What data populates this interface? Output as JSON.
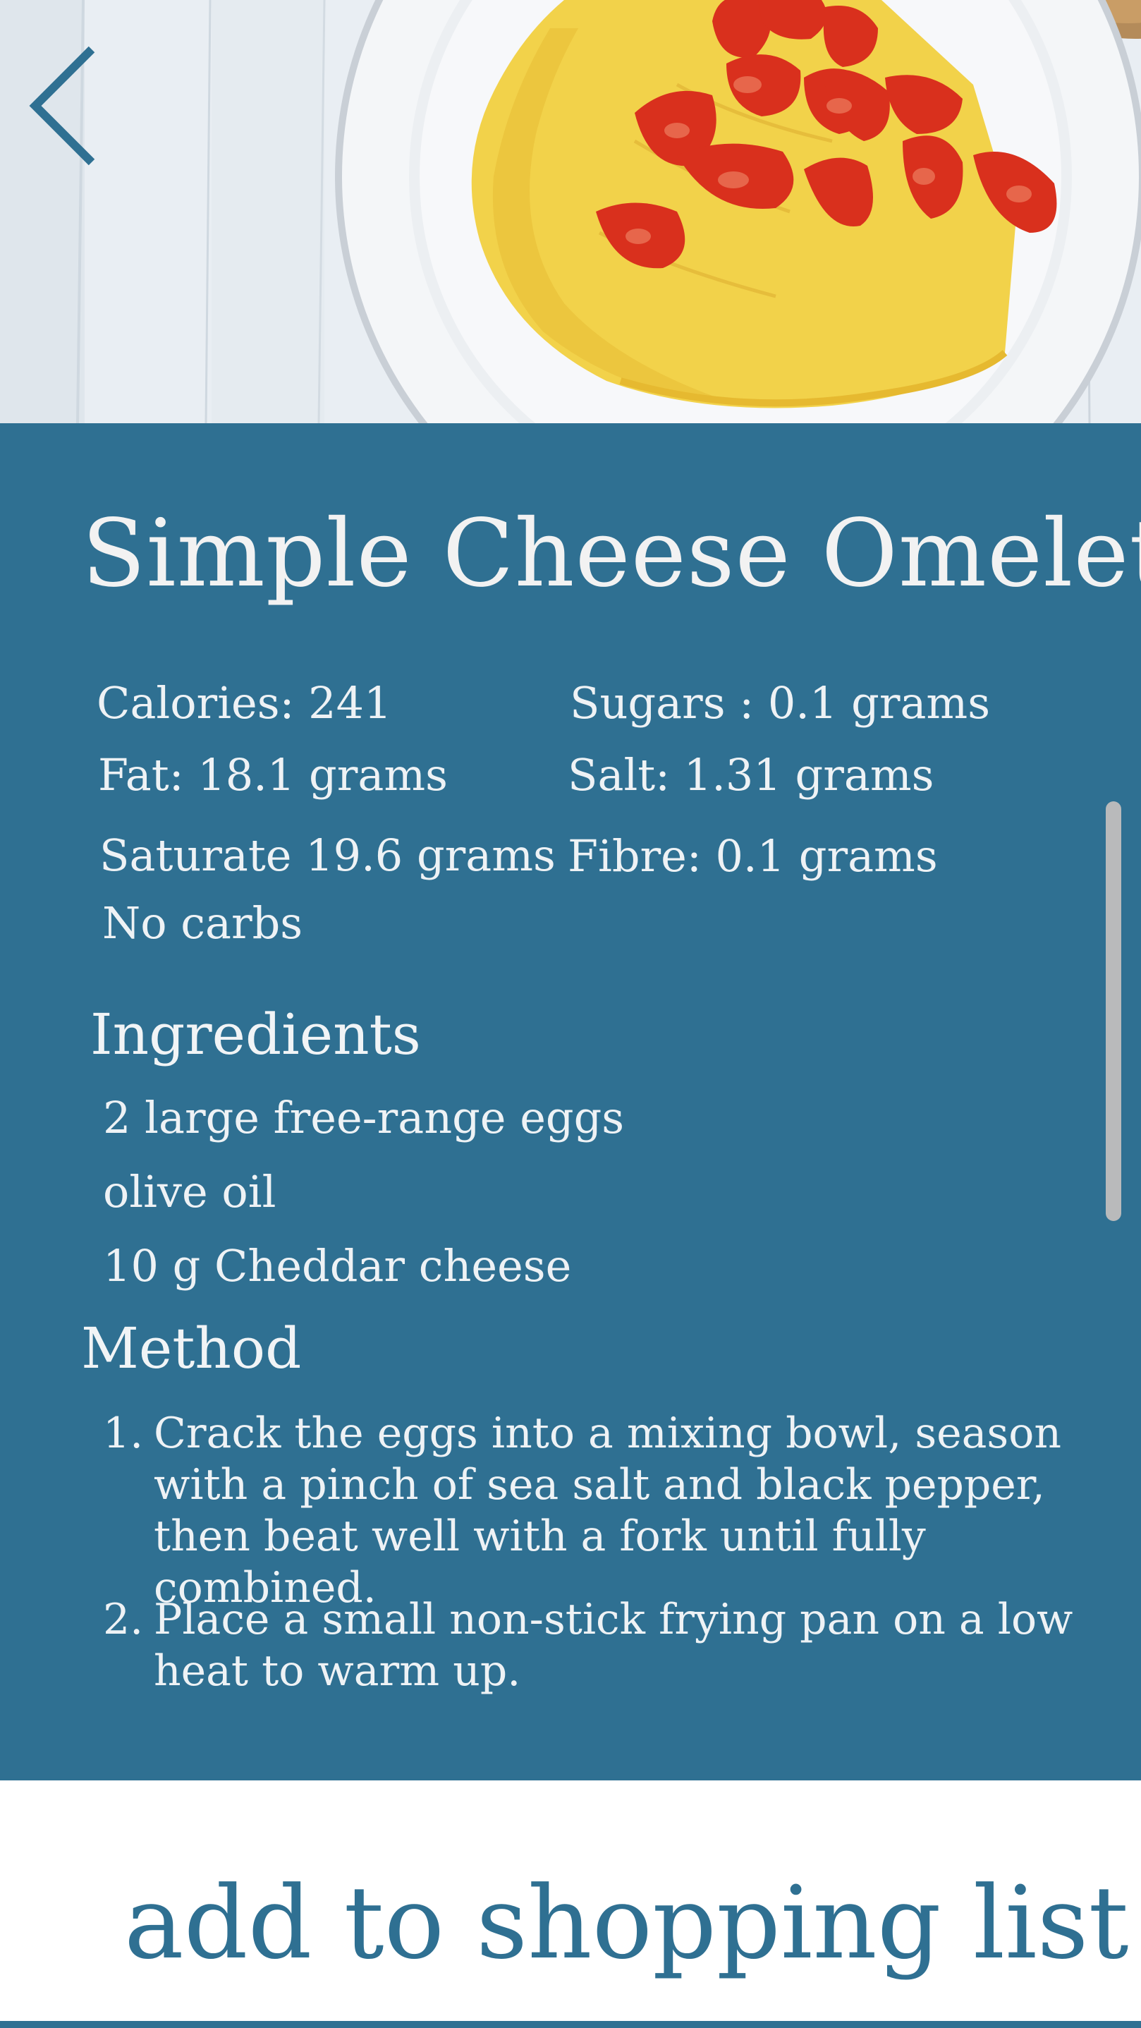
{
  "hero": {
    "back_icon": "chevron-left-icon",
    "image_subject": "omelette-with-cherry-tomatoes"
  },
  "recipe": {
    "title": "Simple Cheese Omelette",
    "nutrition": {
      "calories": "Calories: 241",
      "fat": "Fat: 18.1 grams",
      "saturate": "Saturate 19.6 grams",
      "carbs": "No carbs",
      "sugars": "Sugars : 0.1 grams",
      "salt": "Salt: 1.31 grams",
      "fibre": "Fibre: 0.1 grams"
    },
    "ingredients_heading": "Ingredients",
    "ingredients": [
      "2 large free-range eggs",
      "olive oil",
      "10 g Cheddar cheese"
    ],
    "method_heading": "Method",
    "steps": [
      {
        "number": "1.",
        "text": "Crack the eggs into a mixing bowl, season with a pinch of sea salt and black pepper, then beat well with a fork until fully combined."
      },
      {
        "number": "2.",
        "text": "Place a small non-stick frying pan on a low heat to warm up."
      }
    ]
  },
  "footer": {
    "shopping_button_label": "add to shopping list"
  },
  "colors": {
    "panel": "#2f7092",
    "panel_text": "#eef2f5",
    "button_text": "#2f7092",
    "scrollbar": "#b9babb"
  }
}
